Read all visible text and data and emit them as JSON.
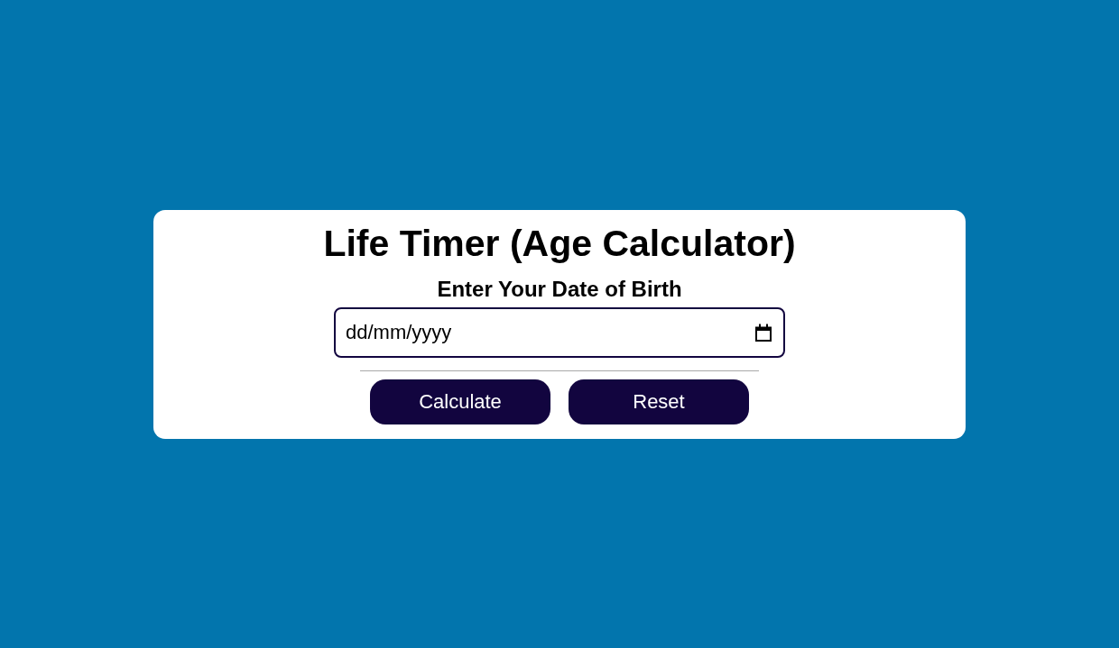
{
  "card": {
    "title": "Life Timer (Age Calculator)",
    "prompt": "Enter Your Date of Birth",
    "date_field": {
      "placeholder": "dd/mm/yyyy"
    },
    "buttons": [
      {
        "label": "Calculate"
      },
      {
        "label": "Reset"
      }
    ]
  }
}
